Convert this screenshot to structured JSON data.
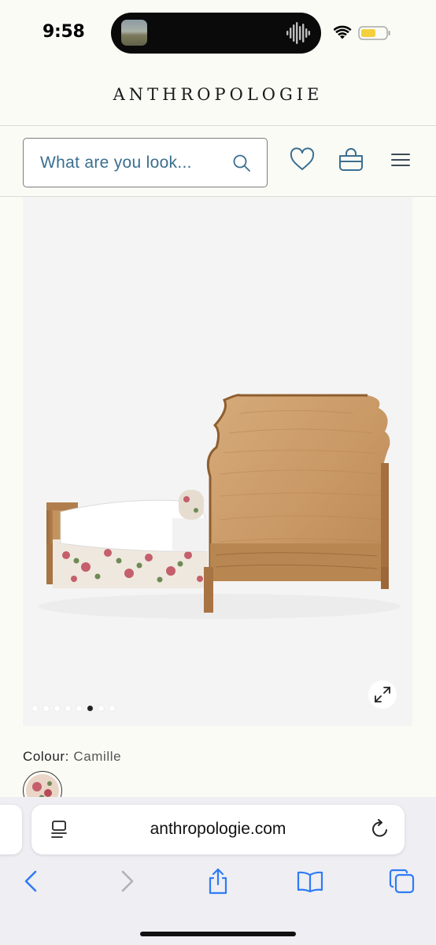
{
  "status_bar": {
    "time": "9:58",
    "icons": [
      "now-playing-thumbnail",
      "audio-waveform-icon",
      "wifi-icon",
      "low-battery-icon"
    ]
  },
  "header": {
    "brand": "ANTHROPOLOGIE",
    "search_placeholder": "What are you look...",
    "icons": [
      "search-icon",
      "heart-icon",
      "bag-icon",
      "menu-icon"
    ]
  },
  "product": {
    "image_description_icon": "expand-icon",
    "carousel": {
      "total": 8,
      "active": 5
    },
    "colour_label": "Colour:",
    "colour_value": "Camille"
  },
  "browser": {
    "url": "anthropologie.com",
    "icons": [
      "reader-icon",
      "reload-icon",
      "back-icon",
      "forward-icon",
      "share-icon",
      "bookmarks-icon",
      "tabs-icon"
    ]
  },
  "colors": {
    "background": "#fbfbf6",
    "accent_blue": "#3a6f90",
    "safari_blue": "#2f7bf5",
    "battery_yellow": "#f4d03f"
  }
}
